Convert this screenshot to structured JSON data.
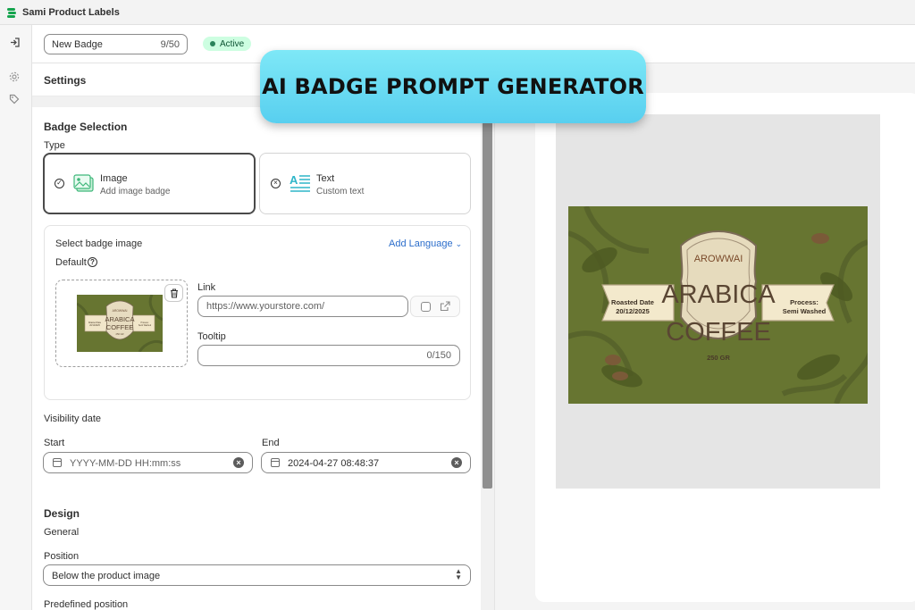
{
  "app": {
    "title": "Sami Product Labels"
  },
  "header": {
    "badge_name": "New Badge",
    "char_count": "9/50",
    "status": "Active"
  },
  "settings": {
    "title": "Settings"
  },
  "badge_selection": {
    "title": "Badge Selection",
    "type_label": "Type",
    "types": [
      {
        "title": "Image",
        "subtitle": "Add image badge",
        "selected": true
      },
      {
        "title": "Text",
        "subtitle": "Custom text",
        "selected": false
      }
    ],
    "select_image_label": "Select badge image",
    "add_language": "Add Language",
    "default_label": "Default",
    "link_label": "Link",
    "link_placeholder": "https://www.yourstore.com/",
    "tooltip_label": "Tooltip",
    "tooltip_count": "0/150"
  },
  "visibility": {
    "title": "Visibility date",
    "start_label": "Start",
    "start_placeholder": "YYYY-MM-DD HH:mm:ss",
    "end_label": "End",
    "end_value": "2024-04-27 08:48:37"
  },
  "design": {
    "title": "Design",
    "general_label": "General",
    "position_label": "Position",
    "position_value": "Below the product image",
    "predefined_label": "Predefined position"
  },
  "banner": {
    "text": "AI BADGE PROMPT GENERATOR"
  },
  "badge_art": {
    "brand": "AROWWAI",
    "line1": "ARABICA",
    "line2": "COFFEE",
    "weight": "250 GR",
    "left_tag_title": "Roasted Date",
    "left_tag_value": "20/12/2025",
    "right_tag_title": "Process:",
    "right_tag_value": "Semi Washed"
  },
  "colors": {
    "badge_green": "#677531",
    "active_bg": "#cdfee1",
    "link_blue": "#2c6ecb",
    "banner_cyan": "#6ddcf3"
  }
}
